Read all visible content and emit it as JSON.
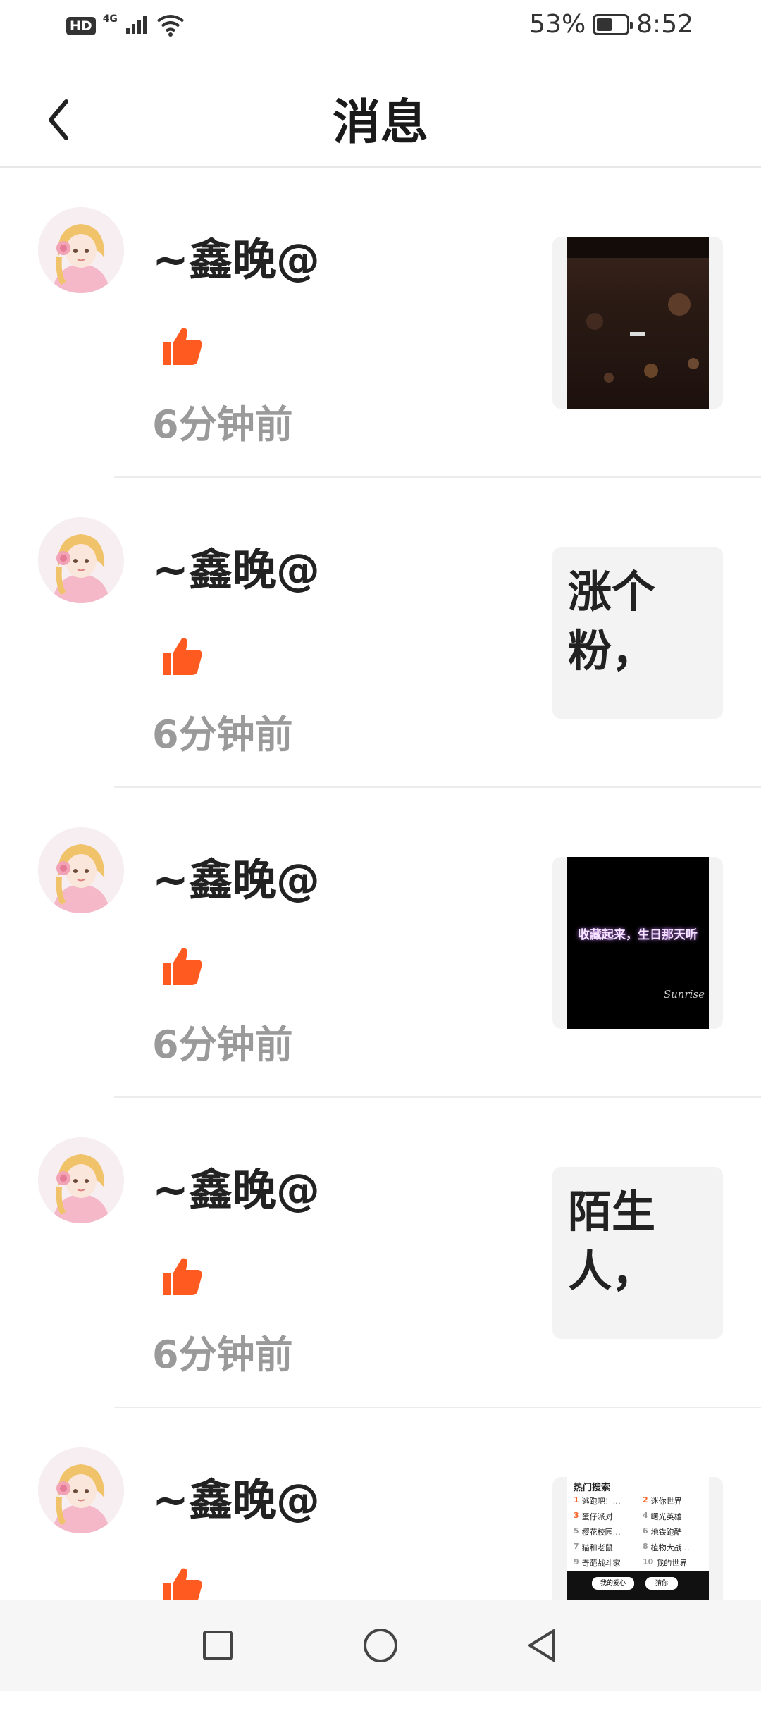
{
  "status_bar": {
    "hd": "HD",
    "network": "4G",
    "battery_text": "53%",
    "battery_level": 0.53,
    "time": "8:52"
  },
  "header": {
    "title": "消息"
  },
  "messages": [
    {
      "username": "~鑫晚@",
      "time": "6分钟前",
      "thumbnail": {
        "kind": "dark-image",
        "caption": "",
        "text": ""
      }
    },
    {
      "username": "~鑫晚@",
      "time": "6分钟前",
      "thumbnail": {
        "kind": "text",
        "text": "涨个粉，"
      }
    },
    {
      "username": "~鑫晚@",
      "time": "6分钟前",
      "thumbnail": {
        "kind": "black-image",
        "caption": "收藏起来，生日那天听",
        "signature": "Sunrise"
      }
    },
    {
      "username": "~鑫晚@",
      "time": "6分钟前",
      "thumbnail": {
        "kind": "text",
        "text": "陌生人，"
      }
    },
    {
      "username": "~鑫晚@",
      "time": "",
      "thumbnail": {
        "kind": "hot-search"
      }
    }
  ],
  "hot_search": {
    "title": "热门搜索",
    "items": [
      {
        "rank": "1",
        "label": "逃跑吧！…"
      },
      {
        "rank": "2",
        "label": "迷你世界"
      },
      {
        "rank": "3",
        "label": "蛋仔派对"
      },
      {
        "rank": "4",
        "label": "曙光英雄"
      },
      {
        "rank": "5",
        "label": "樱花校园…"
      },
      {
        "rank": "6",
        "label": "地铁跑酷"
      },
      {
        "rank": "7",
        "label": "猫和老鼠"
      },
      {
        "rank": "8",
        "label": "植物大战…"
      },
      {
        "rank": "9",
        "label": "奇葩战斗家"
      },
      {
        "rank": "10",
        "label": "我的世界"
      }
    ],
    "btn_left": "我的爱心",
    "btn_right": "猜你"
  },
  "colors": {
    "like": "#ff5a1f",
    "time": "#9a9a9a"
  },
  "icons": {
    "back": "chevron-left-icon",
    "like": "thumbs-up-icon",
    "nav_recent": "square-icon",
    "nav_home": "circle-icon",
    "nav_back": "triangle-back-icon"
  }
}
